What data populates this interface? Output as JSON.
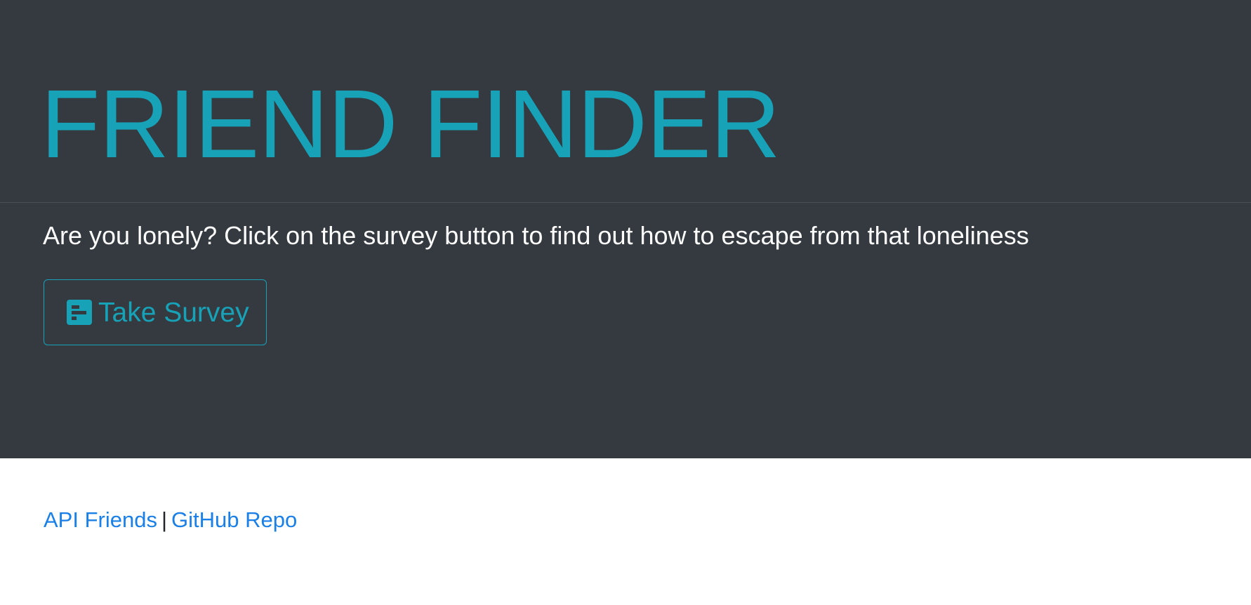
{
  "jumbotron": {
    "title": "FRIEND FINDER",
    "lead": "Are you lonely? Click on the survey button to find out how to escape from that loneliness",
    "survey_button": {
      "label": "Take Survey",
      "icon": "survey-icon"
    },
    "background_color": "#343a40",
    "accent_color": "#17a2b8"
  },
  "footer": {
    "links": [
      {
        "label": "API Friends"
      },
      {
        "label": "GitHub Repo"
      }
    ],
    "separator": "|",
    "link_color": "#1a7fe6"
  }
}
